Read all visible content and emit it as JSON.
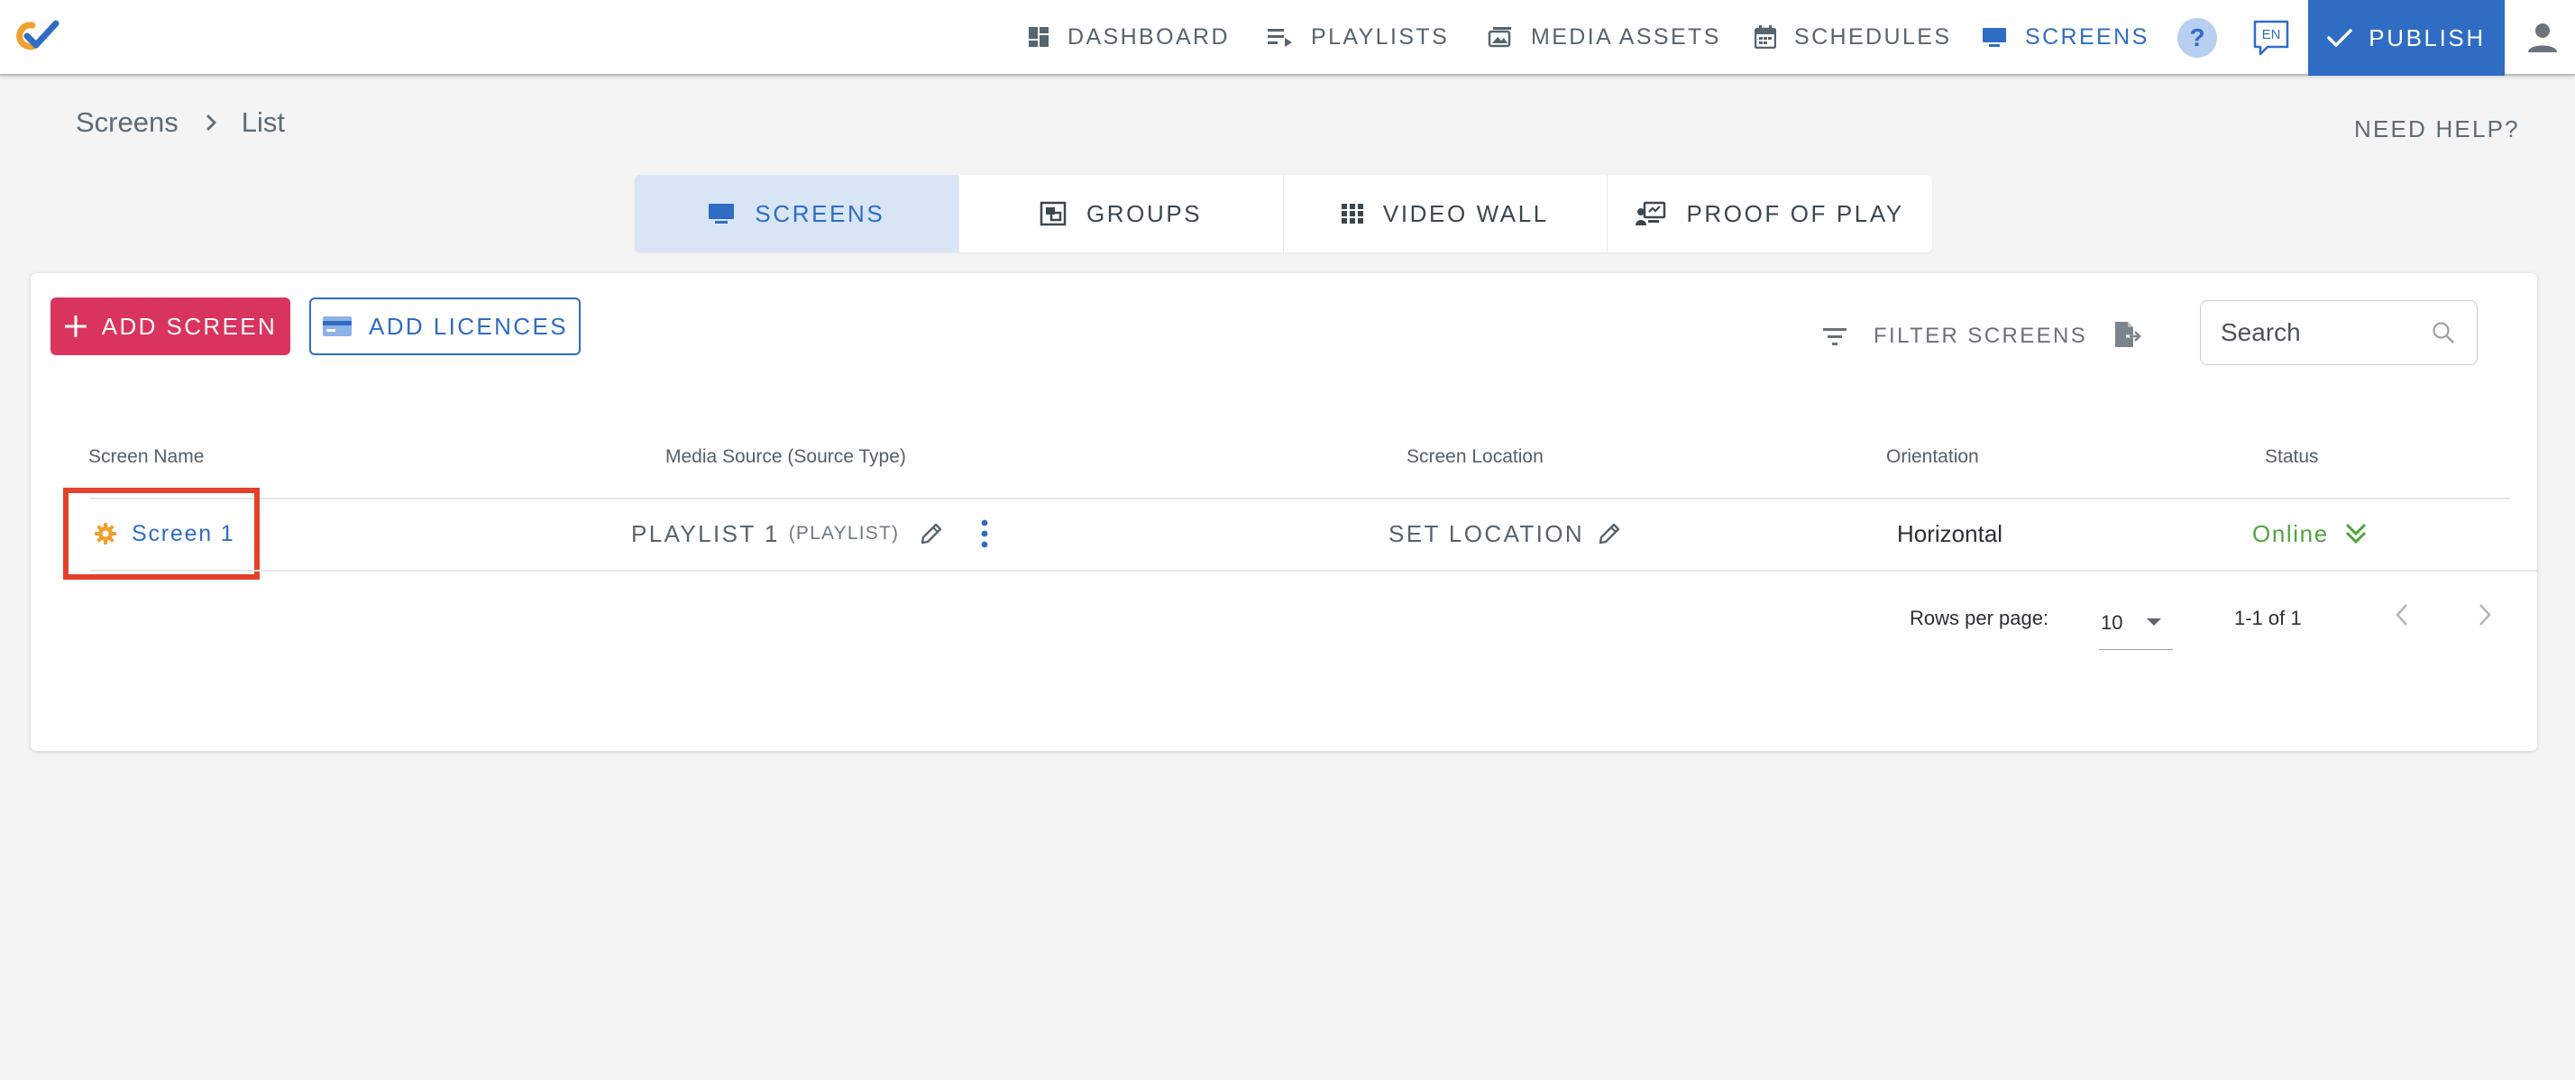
{
  "nav": {
    "items": [
      {
        "label": "DASHBOARD",
        "icon": "dashboard-icon"
      },
      {
        "label": "PLAYLISTS",
        "icon": "playlist-icon"
      },
      {
        "label": "MEDIA ASSETS",
        "icon": "media-assets-icon"
      },
      {
        "label": "SCHEDULES",
        "icon": "calendar-icon"
      },
      {
        "label": "SCREENS",
        "icon": "monitor-icon",
        "active": true
      }
    ],
    "help_glyph": "?",
    "lang_label": "EN",
    "publish_label": "PUBLISH"
  },
  "breadcrumb": {
    "root": "Screens",
    "current": "List"
  },
  "need_help": "NEED HELP?",
  "tabs": [
    {
      "label": "SCREENS",
      "icon": "monitor-icon",
      "active": true
    },
    {
      "label": "GROUPS",
      "icon": "groups-icon"
    },
    {
      "label": "VIDEO WALL",
      "icon": "grid-icon"
    },
    {
      "label": "PROOF OF PLAY",
      "icon": "proof-of-play-icon"
    }
  ],
  "toolbar": {
    "add_screen": "ADD SCREEN",
    "add_licences": "ADD LICENCES",
    "filter": "FILTER SCREENS",
    "search_placeholder": "Search"
  },
  "table": {
    "columns": [
      "Screen Name",
      "Media Source (Source Type)",
      "Screen Location",
      "Orientation",
      "Status"
    ],
    "rows": [
      {
        "screen_name": "Screen 1",
        "media_source": "PLAYLIST 1",
        "source_type": "(PLAYLIST)",
        "location": "SET LOCATION",
        "orientation": "Horizontal",
        "status": "Online"
      }
    ]
  },
  "pagination": {
    "rows_per_page_label": "Rows per page:",
    "rows_per_page": "10",
    "range": "1-1 of 1"
  },
  "colors": {
    "accent": "#2f6cc4",
    "add_screen": "#d9345d",
    "online": "#4fa53e",
    "highlight_box": "#e5412a"
  }
}
